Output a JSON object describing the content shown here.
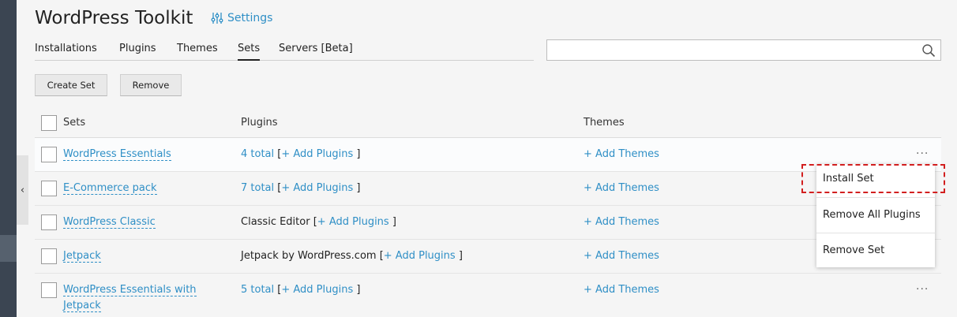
{
  "header": {
    "title": "WordPress Toolkit",
    "settings_label": "Settings",
    "settings_icon": "sliders-icon"
  },
  "tabs": [
    {
      "label": "Installations",
      "active": false
    },
    {
      "label": "Plugins",
      "active": false
    },
    {
      "label": "Themes",
      "active": false
    },
    {
      "label": "Sets",
      "active": true
    },
    {
      "label": "Servers [Beta]",
      "active": false
    }
  ],
  "search": {
    "value": "",
    "placeholder": "",
    "icon": "search-icon"
  },
  "toolbar": {
    "create_label": "Create Set",
    "remove_label": "Remove"
  },
  "table": {
    "columns": [
      "Sets",
      "Plugins",
      "Themes"
    ],
    "add_plugins_label": "+ Add Plugins",
    "add_themes_label": "+ Add Themes",
    "bracket_open": "[",
    "bracket_close": "]",
    "rows": [
      {
        "name": "WordPress Essentials",
        "plugins": "4 total",
        "plugins_is_link": true
      },
      {
        "name": "E-Commerce pack",
        "plugins": "7 total",
        "plugins_is_link": true
      },
      {
        "name": "WordPress Classic",
        "plugins": "Classic Editor",
        "plugins_is_link": false
      },
      {
        "name": "Jetpack",
        "plugins": "Jetpack by WordPress.com",
        "plugins_is_link": false
      },
      {
        "name_line1": "WordPress Essentials with",
        "name_line2": "Jetpack",
        "plugins": "5 total",
        "plugins_is_link": true
      }
    ]
  },
  "row_menu": {
    "trigger": "...",
    "items": [
      "Install Set",
      "Remove All Plugins",
      "Remove Set"
    ]
  },
  "colors": {
    "link": "#2f8fc6",
    "sidebar": "#3b4552",
    "highlight": "#d21f1f"
  }
}
